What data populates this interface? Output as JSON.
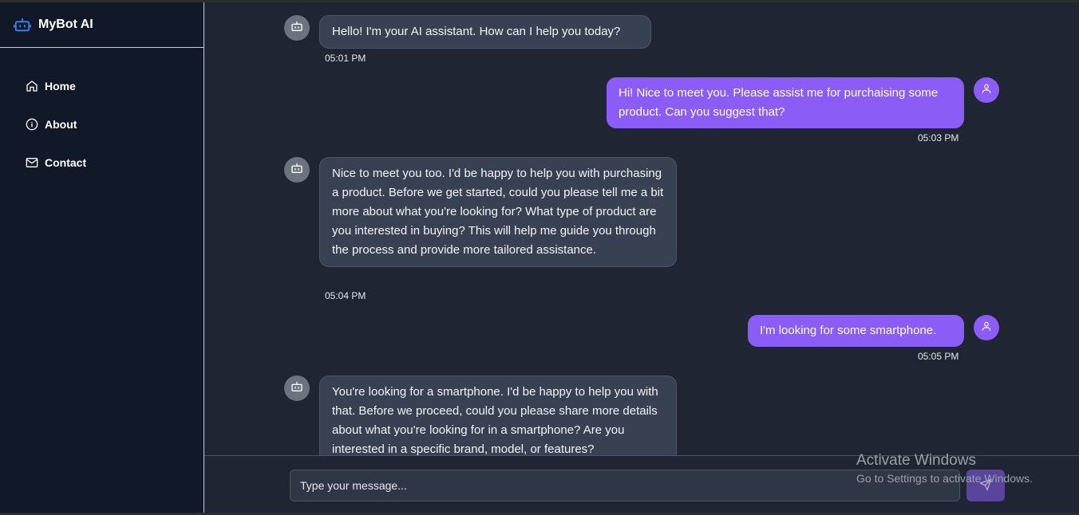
{
  "app": {
    "title": "MyBot AI"
  },
  "sidebar": {
    "items": [
      {
        "label": "Home",
        "icon": "home-icon"
      },
      {
        "label": "About",
        "icon": "info-icon"
      },
      {
        "label": "Contact",
        "icon": "mail-icon"
      }
    ]
  },
  "messages": [
    {
      "sender": "bot",
      "text": "Hello! I'm your AI assistant. How can I help you today?",
      "time": "05:01 PM"
    },
    {
      "sender": "user",
      "text": "Hi! Nice to meet you. Please assist me for purchaising some product. Can you suggest that?",
      "time": "05:03 PM"
    },
    {
      "sender": "bot",
      "text": "Nice to meet you too. I'd be happy to help you with purchasing a product. Before we get started, could you please tell me a bit more about what you're looking for? What type of product are you interested in buying? This will help me guide you through the process and provide more tailored assistance.",
      "time": "05:04 PM"
    },
    {
      "sender": "user",
      "text": "I'm looking for some smartphone.",
      "time": "05:05 PM"
    },
    {
      "sender": "bot",
      "text": "You're looking for a smartphone. I'd be happy to help you with that. Before we proceed, could you please share more details about what you're looking for in a smartphone? Are you interested in a specific brand, model, or features?",
      "time": ""
    }
  ],
  "composer": {
    "placeholder": "Type your message..."
  },
  "watermark": {
    "title": "Activate Windows",
    "subtitle": "Go to Settings to activate Windows."
  },
  "colors": {
    "accent": "#8b5cf6",
    "sidebar_bg": "#111827",
    "main_bg": "#1f2533",
    "bot_bubble": "#374151"
  }
}
